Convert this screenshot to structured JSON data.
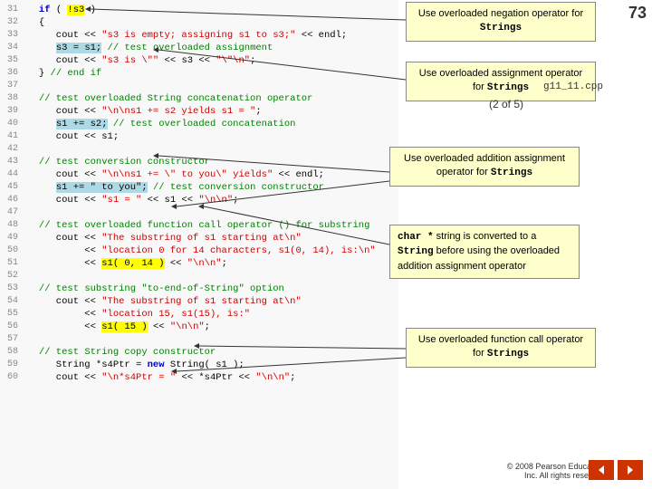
{
  "slide_number": "73",
  "page_indicator": "(2 of 5)",
  "callouts": {
    "negation": {
      "text": "Use overloaded negation operator for ",
      "mono": "Strings"
    },
    "assignment": {
      "text": "Use overloaded assignment operator for ",
      "mono": "Strings"
    },
    "addition_assignment": {
      "text": "Use overloaded addition assignment operator for ",
      "mono": "Strings"
    },
    "char_note": {
      "line1": "char * string is converted to a",
      "line2_pre": "",
      "line2_mono": "String",
      "line2_post": " before using the overloaded",
      "line3": "addition assignment operator"
    },
    "function_call": {
      "text": "Use overloaded function call operator for ",
      "mono": "Strings"
    }
  },
  "file_info": "g11_11.cpp",
  "copyright": "© 2008 Pearson Education,\n    Inc.  All rights reserved.",
  "nav": {
    "back_label": "◀",
    "forward_label": "▶"
  },
  "code_lines": [
    {
      "num": "31",
      "text": "   if ( !s3 )"
    },
    {
      "num": "32",
      "text": "   {"
    },
    {
      "num": "33",
      "text": "      cout << \"s3 is empty; assigning s1 to s3;\" << endl;"
    },
    {
      "num": "34",
      "text": "      s3 = s1; // test overloaded assignment"
    },
    {
      "num": "35",
      "text": "      cout << \"s3 is \\\"\" << s3 << \"\\\"\\n\";"
    },
    {
      "num": "36",
      "text": "   } // end if"
    },
    {
      "num": "37",
      "text": ""
    },
    {
      "num": "38",
      "text": "   // test overloaded String concatenation operator"
    },
    {
      "num": "39",
      "text": "      cout << \"\\n\\ns1 += s2 yields s1 = \";"
    },
    {
      "num": "40",
      "text": "      s1 += s2; // test overloaded concatenation"
    },
    {
      "num": "41",
      "text": "      cout << s1;"
    },
    {
      "num": "42",
      "text": ""
    },
    {
      "num": "43",
      "text": "   // test conversion constructor"
    },
    {
      "num": "44",
      "text": "      cout << \"\\n\\ns1 += \\\" to you\\\" yields\" << endl;"
    },
    {
      "num": "45",
      "text": "      s1 += \" to you\"; // test conversion constructor"
    },
    {
      "num": "46",
      "text": "      cout << \"s1 = \" << s1 << \"\\n\\n\";"
    },
    {
      "num": "47",
      "text": ""
    },
    {
      "num": "48",
      "text": "   // test overloaded function call operator () for substring"
    },
    {
      "num": "49",
      "text": "      cout << \"The substring of s1 starting at\\n\""
    },
    {
      "num": "50",
      "text": "           << \"location 0 for 14 characters, s1(0, 14), is:\\n\""
    },
    {
      "num": "51",
      "text": "           << s1( 0, 14 ) << \"\\n\\n\";"
    },
    {
      "num": "52",
      "text": ""
    },
    {
      "num": "53",
      "text": "   // test substring \"to-end-of-String\" option"
    },
    {
      "num": "54",
      "text": "      cout << \"The substring of s1 starting at\\n\""
    },
    {
      "num": "55",
      "text": "           << \"location 15, s1(15), is:\""
    },
    {
      "num": "56",
      "text": "           << s1( 15 ) << \"\\n\\n\";"
    },
    {
      "num": "57",
      "text": ""
    },
    {
      "num": "58",
      "text": "   // test String copy constructor"
    },
    {
      "num": "59",
      "text": "      String *s4Ptr = new String( s1 );"
    },
    {
      "num": "60",
      "text": "      cout << \"\\n*s4Ptr = \" << *s4Ptr << \"\\n\\n\";"
    }
  ]
}
